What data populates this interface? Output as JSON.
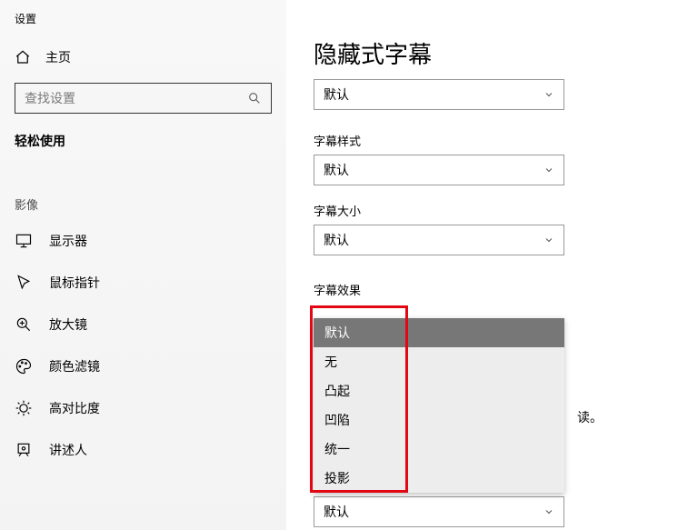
{
  "sidebar": {
    "settings": "设置",
    "home": "主页",
    "search_placeholder": "查找设置",
    "section": "轻松使用",
    "group": "影像",
    "items": [
      {
        "label": "显示器",
        "name": "display"
      },
      {
        "label": "鼠标指针",
        "name": "cursor"
      },
      {
        "label": "放大镜",
        "name": "magnifier"
      },
      {
        "label": "颜色滤镜",
        "name": "color-filters"
      },
      {
        "label": "高对比度",
        "name": "high-contrast"
      },
      {
        "label": "讲述人",
        "name": "narrator"
      }
    ]
  },
  "main": {
    "title": "隐藏式字幕",
    "select1_value": "默认",
    "fields": [
      {
        "label": "字幕样式",
        "value": "默认"
      },
      {
        "label": "字幕大小",
        "value": "默认"
      },
      {
        "label": "字幕效果",
        "value": "默认"
      }
    ],
    "dropdown_options": [
      "默认",
      "无",
      "凸起",
      "凹陷",
      "统一",
      "投影"
    ],
    "bottom_value": "默认",
    "read_suffix": "读。"
  }
}
